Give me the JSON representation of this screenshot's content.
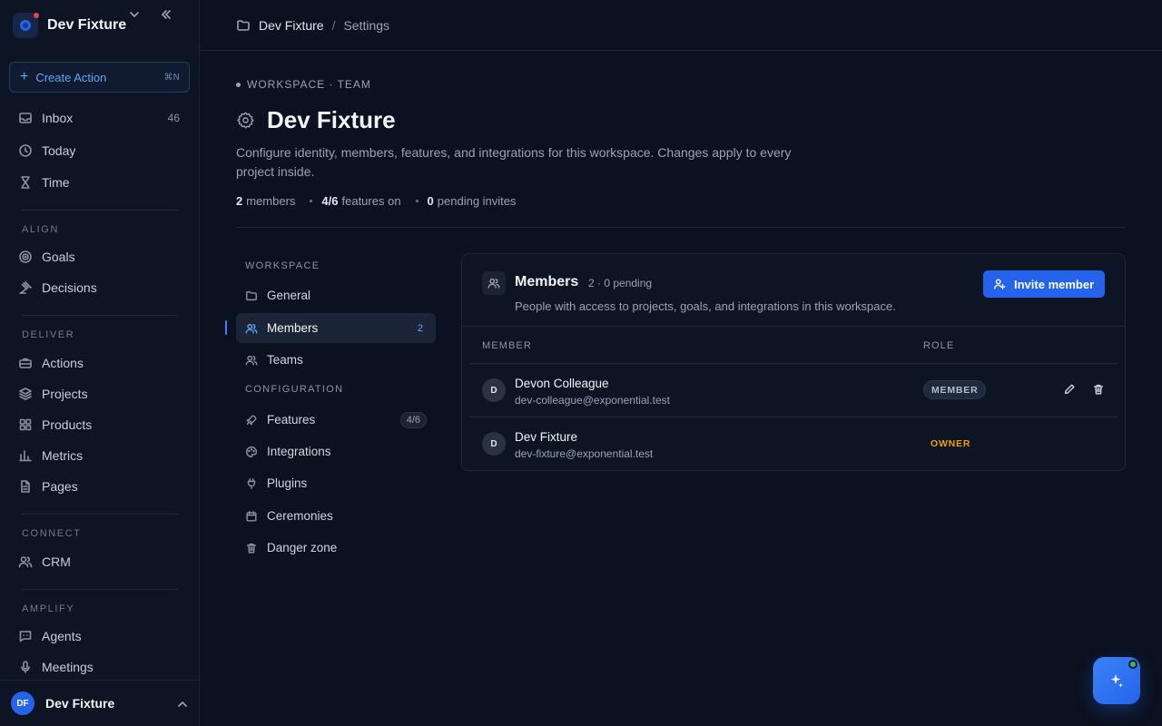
{
  "workspace": {
    "name": "Dev Fixture"
  },
  "create_action": {
    "label": "Create Action",
    "shortcut": "⌘N"
  },
  "nav": {
    "main": [
      {
        "label": "Inbox",
        "count": "46",
        "icon": "inbox-icon"
      },
      {
        "label": "Today",
        "icon": "clock-icon"
      },
      {
        "label": "Time",
        "icon": "hourglass-icon"
      }
    ],
    "sections": {
      "align": "ALIGN",
      "deliver": "DELIVER",
      "connect": "CONNECT",
      "amplify": "AMPLIFY"
    },
    "align": [
      {
        "label": "Goals",
        "icon": "target-icon"
      },
      {
        "label": "Decisions",
        "icon": "gavel-icon"
      }
    ],
    "deliver": [
      {
        "label": "Actions",
        "icon": "briefcase-icon"
      },
      {
        "label": "Projects",
        "icon": "layers-icon"
      },
      {
        "label": "Products",
        "icon": "grid-icon"
      },
      {
        "label": "Metrics",
        "icon": "bar-chart-icon"
      },
      {
        "label": "Pages",
        "icon": "file-icon"
      }
    ],
    "connect": [
      {
        "label": "CRM",
        "icon": "users-icon"
      }
    ],
    "amplify": [
      {
        "label": "Agents",
        "icon": "message-bot-icon"
      },
      {
        "label": "Meetings",
        "icon": "microphone-icon"
      }
    ]
  },
  "user": {
    "initials": "DF",
    "name": "Dev Fixture"
  },
  "breadcrumb": {
    "workspace": "Dev Fixture",
    "separator": "/",
    "page": "Settings"
  },
  "header": {
    "eyebrow": "WORKSPACE · TEAM",
    "title": "Dev Fixture",
    "description": "Configure identity, members, features, and integrations for this workspace. Changes apply to every project inside.",
    "stats": [
      {
        "value": "2",
        "label": "members"
      },
      {
        "value": "4/6",
        "label": "features on"
      },
      {
        "value": "0",
        "label": "pending invites"
      }
    ]
  },
  "settings_nav": {
    "workspace_label": "WORKSPACE",
    "configuration_label": "CONFIGURATION",
    "workspace_items": [
      {
        "label": "General",
        "icon": "folder-icon"
      },
      {
        "label": "Members",
        "count": "2",
        "icon": "users-icon",
        "active": true
      },
      {
        "label": "Teams",
        "icon": "users-icon"
      }
    ],
    "configuration_items": [
      {
        "label": "Features",
        "count": "4/6",
        "icon": "rocket-icon"
      },
      {
        "label": "Integrations",
        "icon": "palette-icon"
      },
      {
        "label": "Plugins",
        "icon": "plug-icon"
      },
      {
        "label": "Ceremonies",
        "icon": "calendar-icon"
      },
      {
        "label": "Danger zone",
        "icon": "trash-icon"
      }
    ]
  },
  "members": {
    "title": "Members",
    "meta": "2 · 0 pending",
    "subtitle": "People with access to projects, goals, and integrations in this workspace.",
    "invite_label": "Invite member",
    "columns": {
      "member": "MEMBER",
      "role": "ROLE"
    },
    "rows": [
      {
        "initial": "D",
        "name": "Devon Colleague",
        "email": "dev-colleague@exponential.test",
        "role": "MEMBER"
      },
      {
        "initial": "D",
        "name": "Dev Fixture",
        "email": "dev-fixture@exponential.test",
        "role": "OWNER"
      }
    ]
  },
  "colors": {
    "accent": "#2563eb",
    "owner": "#f59e0b",
    "background": "#0b1120",
    "online": "#22c55e"
  }
}
